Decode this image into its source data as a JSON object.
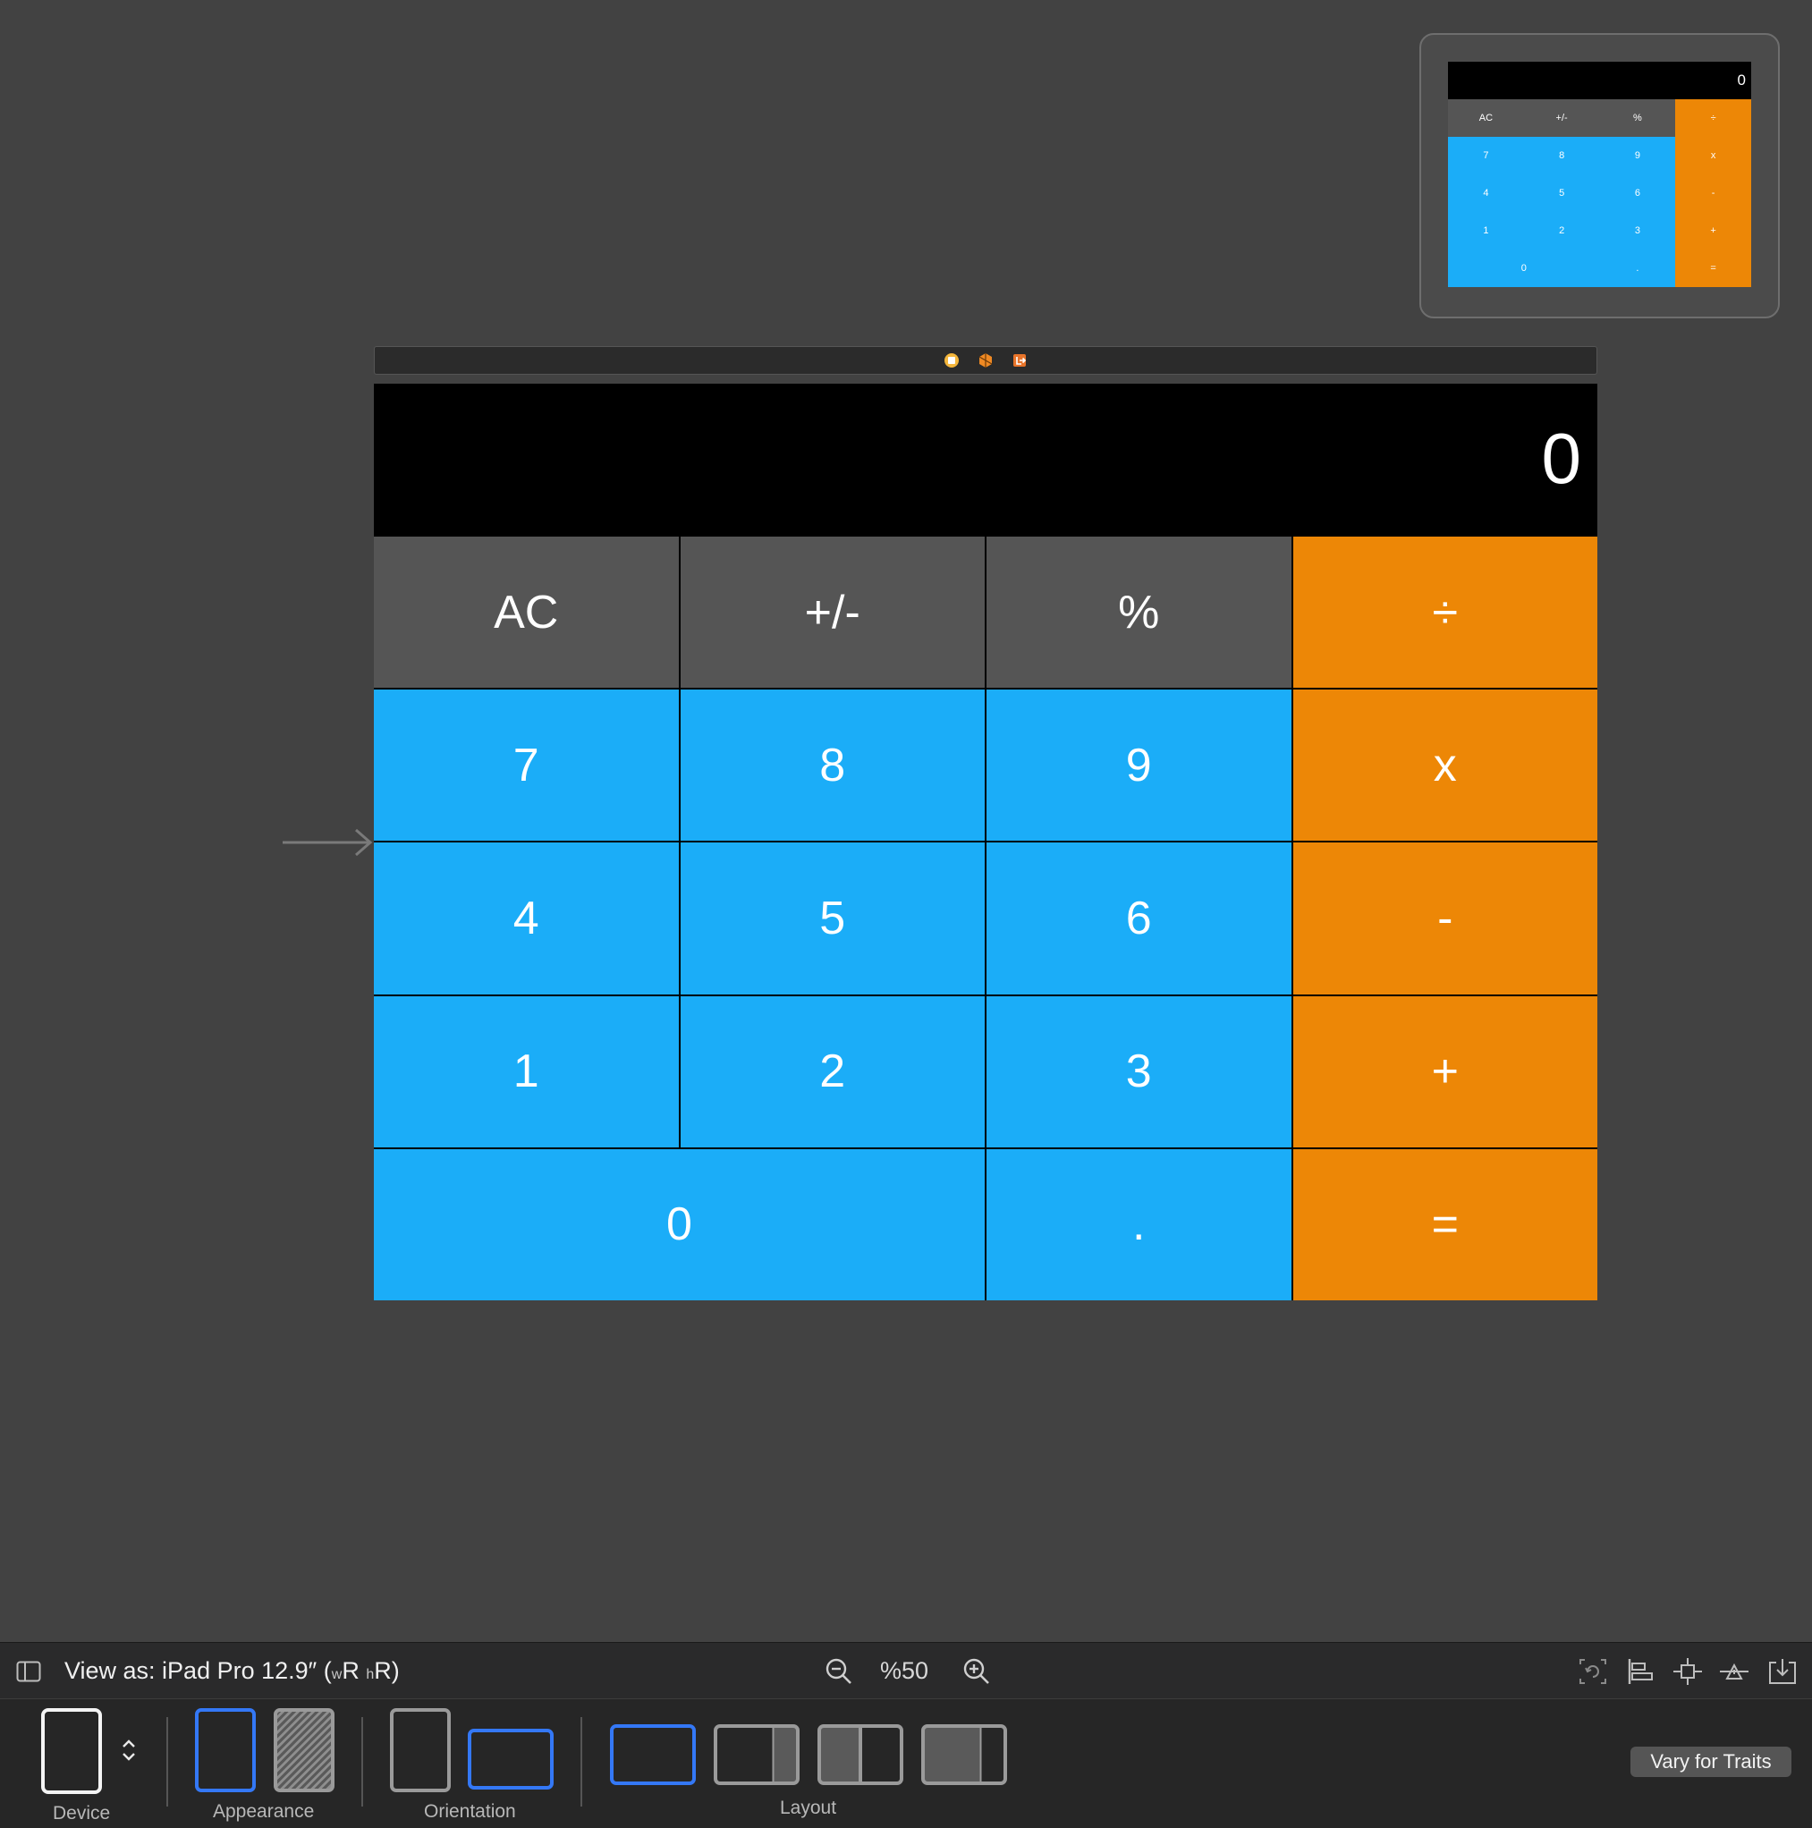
{
  "minimap": {
    "display": "0",
    "rows": [
      [
        {
          "t": "AC",
          "c": "g"
        },
        {
          "t": "+/-",
          "c": "g"
        },
        {
          "t": "%",
          "c": "g"
        },
        {
          "t": "÷",
          "c": "o"
        }
      ],
      [
        {
          "t": "7",
          "c": "b"
        },
        {
          "t": "8",
          "c": "b"
        },
        {
          "t": "9",
          "c": "b"
        },
        {
          "t": "x",
          "c": "o"
        }
      ],
      [
        {
          "t": "4",
          "c": "b"
        },
        {
          "t": "5",
          "c": "b"
        },
        {
          "t": "6",
          "c": "b"
        },
        {
          "t": "-",
          "c": "o"
        }
      ],
      [
        {
          "t": "1",
          "c": "b"
        },
        {
          "t": "2",
          "c": "b"
        },
        {
          "t": "3",
          "c": "b"
        },
        {
          "t": "+",
          "c": "o"
        }
      ],
      [
        {
          "t": "0",
          "c": "b",
          "wide": true
        },
        {
          "t": ".",
          "c": "b"
        },
        {
          "t": "=",
          "c": "o"
        }
      ]
    ]
  },
  "scene_bar": {
    "icons": [
      "view-controller-icon",
      "first-responder-icon",
      "exit-icon"
    ]
  },
  "calculator": {
    "display_value": "0",
    "keys": [
      {
        "label": "AC",
        "style": "gray",
        "name": "key-ac"
      },
      {
        "label": "+/-",
        "style": "gray",
        "name": "key-plus-minus"
      },
      {
        "label": "%",
        "style": "gray",
        "name": "key-percent"
      },
      {
        "label": "÷",
        "style": "orange",
        "name": "key-divide"
      },
      {
        "label": "7",
        "style": "blue",
        "name": "key-7"
      },
      {
        "label": "8",
        "style": "blue",
        "name": "key-8"
      },
      {
        "label": "9",
        "style": "blue",
        "name": "key-9"
      },
      {
        "label": "x",
        "style": "orange",
        "name": "key-multiply"
      },
      {
        "label": "4",
        "style": "blue",
        "name": "key-4"
      },
      {
        "label": "5",
        "style": "blue",
        "name": "key-5"
      },
      {
        "label": "6",
        "style": "blue",
        "name": "key-6"
      },
      {
        "label": "-",
        "style": "orange",
        "name": "key-minus"
      },
      {
        "label": "1",
        "style": "blue",
        "name": "key-1"
      },
      {
        "label": "2",
        "style": "blue",
        "name": "key-2"
      },
      {
        "label": "3",
        "style": "blue",
        "name": "key-3"
      },
      {
        "label": "+",
        "style": "orange",
        "name": "key-plus"
      },
      {
        "label": "0",
        "style": "blue",
        "name": "key-0",
        "wide": true
      },
      {
        "label": ".",
        "style": "blue",
        "name": "key-decimal"
      },
      {
        "label": "=",
        "style": "orange",
        "name": "key-equals"
      }
    ]
  },
  "colors": {
    "canvas": "#424242",
    "key_gray": "#555555",
    "key_blue": "#1badf8",
    "key_orange": "#ed8706",
    "selection_blue": "#3478f6"
  },
  "toolbar": {
    "view_as_prefix": "View as: iPad Pro 12.9″",
    "size_class_open": "(",
    "size_class_w": "w",
    "size_class_wr": "R",
    "size_class_h": "h",
    "size_class_hr": "R",
    "size_class_close": ")",
    "zoom_level": "%50"
  },
  "traits": {
    "device_label": "Device",
    "appearance_label": "Appearance",
    "orientation_label": "Orientation",
    "layout_label": "Layout",
    "vary_button": "Vary for Traits"
  }
}
